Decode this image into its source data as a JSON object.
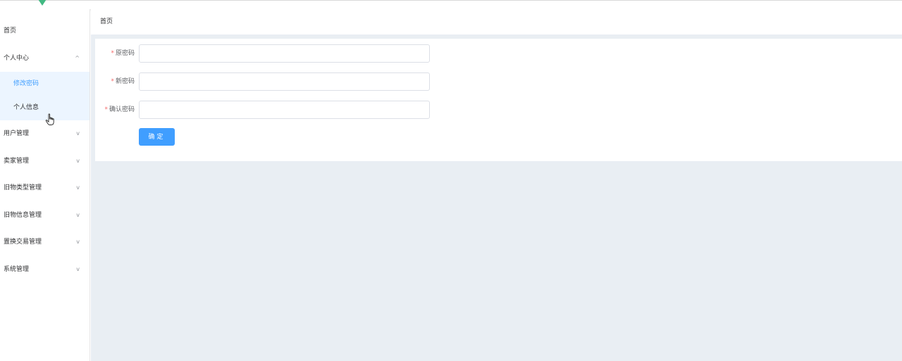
{
  "breadcrumb": {
    "home": "首页"
  },
  "sidebar": {
    "items": [
      {
        "label": "首页"
      },
      {
        "label": "个人中心",
        "arrow": "chevron-up",
        "arrow_glyph": "^"
      },
      {
        "label": "用户管理",
        "arrow": "chevron-down",
        "arrow_glyph": "v"
      },
      {
        "label": "卖家管理",
        "arrow": "chevron-down",
        "arrow_glyph": "v"
      },
      {
        "label": "旧物类型管理",
        "arrow": "chevron-down",
        "arrow_glyph": "v"
      },
      {
        "label": "旧物信息管理",
        "arrow": "chevron-down",
        "arrow_glyph": "v"
      },
      {
        "label": "置换交易管理",
        "arrow": "chevron-down",
        "arrow_glyph": "v"
      },
      {
        "label": "系统管理",
        "arrow": "chevron-down",
        "arrow_glyph": "v"
      }
    ],
    "subitems": [
      {
        "label": "修改密码",
        "active": true
      },
      {
        "label": "个人信息"
      }
    ]
  },
  "form": {
    "required_mark": "*",
    "fields": [
      {
        "label": "原密码",
        "value": ""
      },
      {
        "label": "新密码",
        "value": ""
      },
      {
        "label": "确认密码",
        "value": ""
      }
    ],
    "submit_label": "确定"
  },
  "colors": {
    "accent": "#409eff",
    "required": "#f56c6c",
    "main_bg": "#e9eef3",
    "submenu_bg": "#ecf5ff",
    "logo": "#42b983"
  }
}
